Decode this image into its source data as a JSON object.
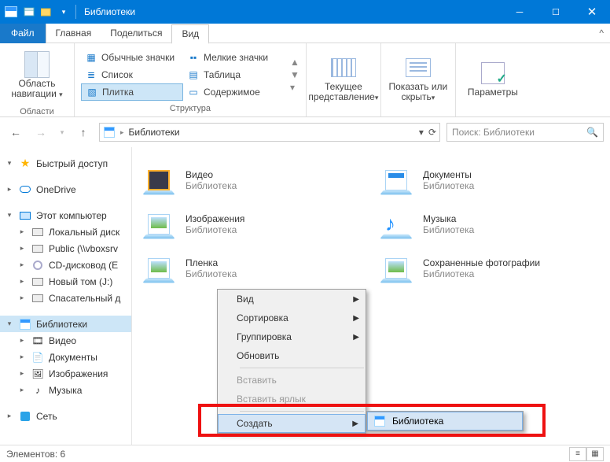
{
  "window": {
    "title": "Библиотеки"
  },
  "tabs": {
    "file": "Файл",
    "home": "Главная",
    "share": "Поделиться",
    "view": "Вид"
  },
  "ribbon": {
    "nav_area": {
      "label": "Область навигации",
      "group": "Области"
    },
    "layout": {
      "regular": "Обычные значки",
      "small": "Мелкие значки",
      "list": "Список",
      "table": "Таблица",
      "tile": "Плитка",
      "content": "Содержимое",
      "group": "Структура"
    },
    "currentview": {
      "label": "Текущее представление"
    },
    "showhide": {
      "label": "Показать или скрыть"
    },
    "options": {
      "label": "Параметры"
    }
  },
  "addr": {
    "location": "Библиотеки"
  },
  "search": {
    "placeholder": "Поиск: Библиотеки"
  },
  "nav": {
    "quick": "Быстрый доступ",
    "onedrive": "OneDrive",
    "thispc": "Этот компьютер",
    "ldisk": "Локальный диск",
    "public": "Public (\\\\vboxsrv",
    "cd": "CD-дисковод (E",
    "newvol": "Новый том (J:)",
    "rescue": "Спасательный д",
    "libraries": "Библиотеки",
    "video": "Видео",
    "docs": "Документы",
    "images": "Изображения",
    "music": "Музыка",
    "network": "Сеть"
  },
  "lib_sub": "Библиотека",
  "libs": {
    "video": "Видео",
    "docs": "Документы",
    "images": "Изображения",
    "music": "Музыка",
    "film": "Пленка",
    "saved": "Сохраненные фотографии"
  },
  "ctx": {
    "view": "Вид",
    "sort": "Сортировка",
    "group": "Группировка",
    "refresh": "Обновить",
    "paste": "Вставить",
    "paste_shortcut": "Вставить ярлык",
    "create": "Создать"
  },
  "submenu": {
    "library": "Библиотека"
  },
  "status": {
    "text": "Элементов: 6"
  }
}
